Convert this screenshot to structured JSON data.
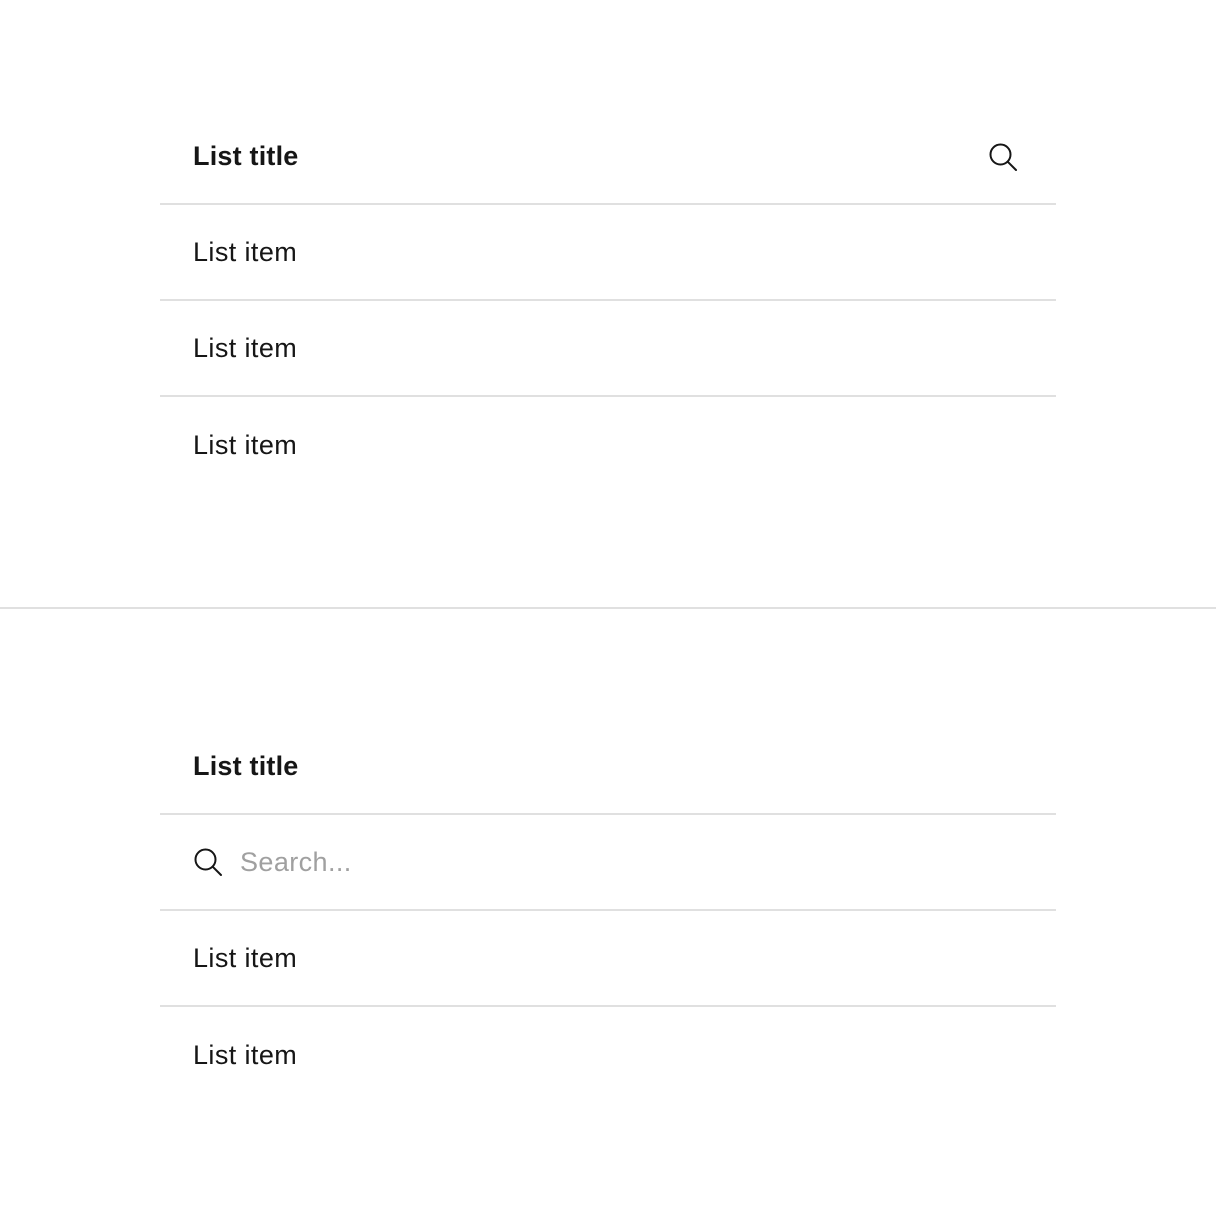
{
  "top_list": {
    "title": "List title",
    "search_icon": "search-icon",
    "items": [
      "List item",
      "List item",
      "List item"
    ]
  },
  "bottom_list": {
    "title": "List title",
    "search": {
      "icon": "search-icon",
      "placeholder": "Search...",
      "value": ""
    },
    "items": [
      "List item",
      "List item"
    ]
  }
}
